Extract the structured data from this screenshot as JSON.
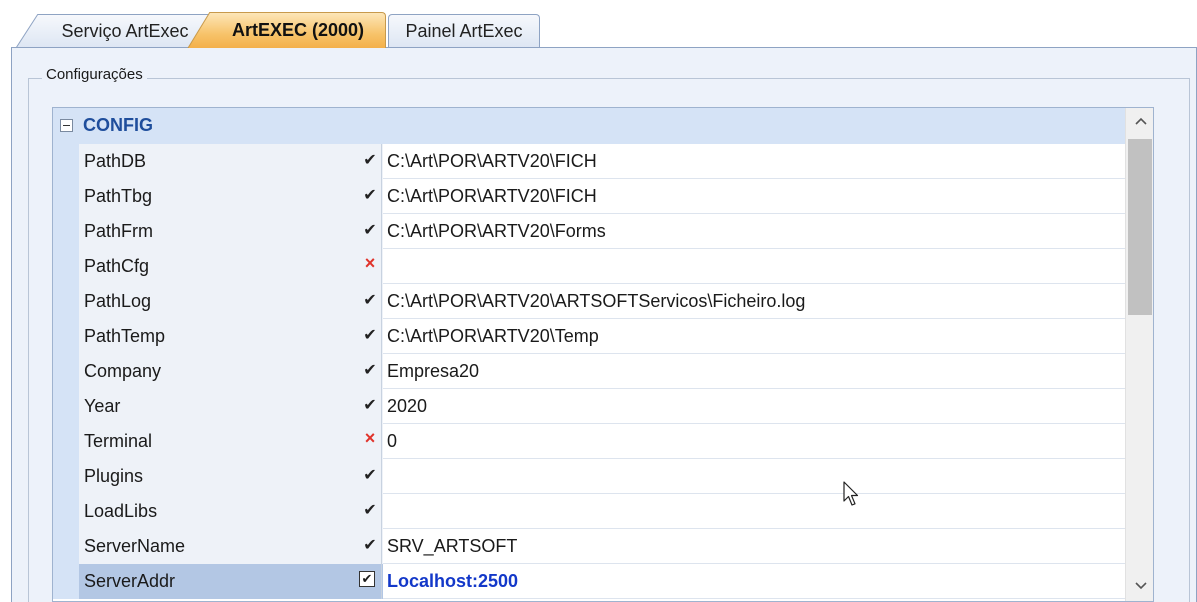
{
  "tabs": [
    {
      "label": "Serviço ArtExec"
    },
    {
      "label": "ArtEXEC (2000)"
    },
    {
      "label": "Painel ArtExec"
    }
  ],
  "active_tab": "ArtEXEC (2000)",
  "group_label": "Configurações",
  "category": {
    "label": "CONFIG",
    "expanded": true
  },
  "properties": [
    {
      "name": "PathDB",
      "status": "ok",
      "value": "C:\\Art\\POR\\ARTV20\\FICH"
    },
    {
      "name": "PathTbg",
      "status": "ok",
      "value": "C:\\Art\\POR\\ARTV20\\FICH"
    },
    {
      "name": "PathFrm",
      "status": "ok",
      "value": "C:\\Art\\POR\\ARTV20\\Forms"
    },
    {
      "name": "PathCfg",
      "status": "error",
      "value": ""
    },
    {
      "name": "PathLog",
      "status": "ok",
      "value": "C:\\Art\\POR\\ARTV20\\ARTSOFTServicos\\Ficheiro.log"
    },
    {
      "name": "PathTemp",
      "status": "ok",
      "value": "C:\\Art\\POR\\ARTV20\\Temp"
    },
    {
      "name": "Company",
      "status": "ok",
      "value": "Empresa20"
    },
    {
      "name": "Year",
      "status": "ok",
      "value": "2020"
    },
    {
      "name": "Terminal",
      "status": "error",
      "value": "0"
    },
    {
      "name": "Plugins",
      "status": "ok",
      "value": ""
    },
    {
      "name": "LoadLibs",
      "status": "ok",
      "value": ""
    },
    {
      "name": "ServerName",
      "status": "ok",
      "value": "SRV_ARTSOFT"
    },
    {
      "name": "ServerAddr",
      "status": "checkbox",
      "value": "Localhost:2500",
      "selected": true
    }
  ],
  "icons": {
    "ok": "check-icon",
    "error": "cross-icon",
    "checkbox": "checkbox-icon"
  },
  "colors": {
    "selected_value": "#1338c9",
    "category_text": "#1f4e9c",
    "error_mark": "#e0332b",
    "active_tab": "#f7c36a"
  }
}
